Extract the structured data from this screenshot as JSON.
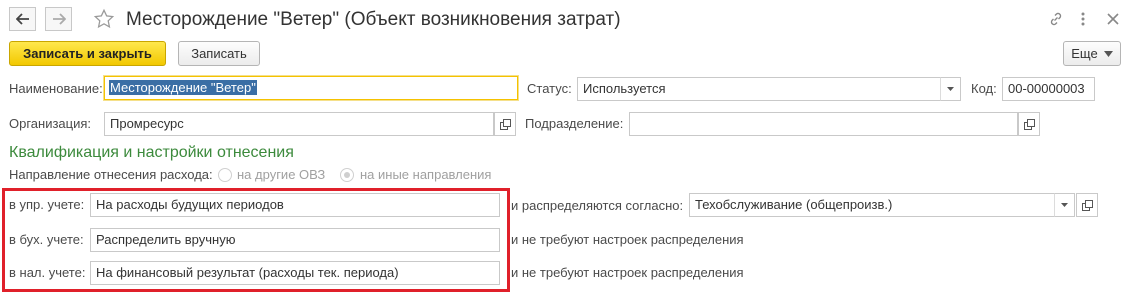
{
  "window": {
    "title": "Месторождение \"Ветер\" (Объект возникновения затрат)"
  },
  "toolbar": {
    "save_close_label": "Записать и закрыть",
    "save_label": "Записать",
    "more_label": "Еще"
  },
  "form": {
    "name_label": "Наименование:",
    "name_value": "Месторождение \"Ветер\"",
    "status_label": "Статус:",
    "status_value": "Используется",
    "code_label": "Код:",
    "code_value": "00-00000003",
    "org_label": "Организация:",
    "org_value": "Промресурс",
    "division_label": "Подразделение:",
    "division_value": ""
  },
  "section": {
    "title": "Квалификация и настройки отнесения",
    "direction_label": "Направление отнесения расхода:",
    "radio_options": [
      {
        "label": "на другие ОВЗ",
        "checked": false
      },
      {
        "label": "на иные направления",
        "checked": true
      }
    ]
  },
  "accounting_rows": [
    {
      "label": "в упр. учете:",
      "value": "На расходы будущих периодов",
      "note": "и распределяются согласно:",
      "distribution": "Техобслуживание (общепроизв.)"
    },
    {
      "label": "в бух. учете:",
      "value": "Распределить вручную",
      "note": "и не требуют настроек распределения"
    },
    {
      "label": "в нал. учете:",
      "value": "На финансовый результат (расходы тек. периода)",
      "note": "и не требуют настроек распределения"
    }
  ]
}
